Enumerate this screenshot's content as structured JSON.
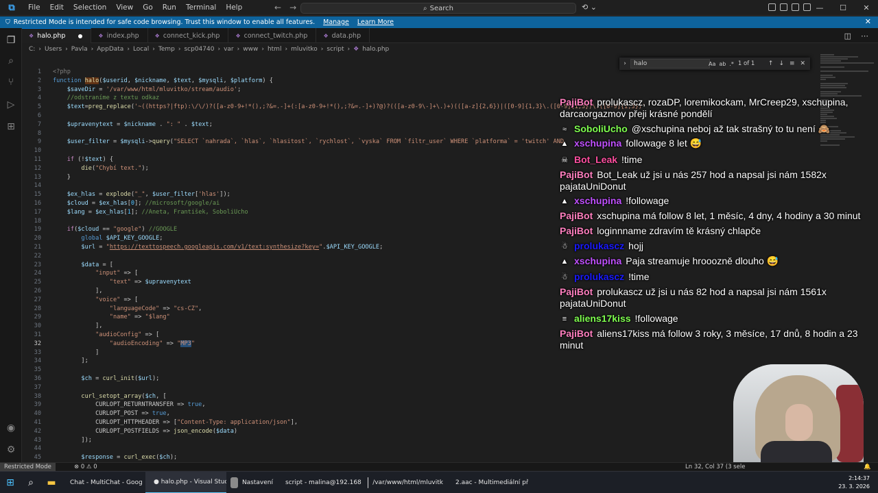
{
  "titlebar": {
    "menu": [
      "File",
      "Edit",
      "Selection",
      "View",
      "Go",
      "Run",
      "Terminal",
      "Help"
    ],
    "search_label": "Search"
  },
  "banner": {
    "text": "Restricted Mode is intended for safe code browsing. Trust this window to enable all features.",
    "manage": "Manage",
    "learn_more": "Learn More"
  },
  "tabs": [
    "halo.php",
    "index.php",
    "connect_kick.php",
    "connect_twitch.php",
    "data.php"
  ],
  "breadcrumb": [
    "C:",
    "Users",
    "Pavla",
    "AppData",
    "Local",
    "Temp",
    "scp04740",
    "var",
    "www",
    "html",
    "mluvitko",
    "script",
    "halo.php"
  ],
  "find": {
    "query": "halo",
    "count": "1 of 1",
    "opt_case": "Aa",
    "opt_word": "ab",
    "opt_regex": ".*"
  },
  "editor": {
    "line_numbers": [
      "1",
      "2",
      "3",
      "4",
      "5",
      "6",
      "7",
      "8",
      "9",
      "10",
      "11",
      "12",
      "13",
      "14",
      "15",
      "16",
      "17",
      "18",
      "19",
      "20",
      "21",
      "22",
      "23",
      "24",
      "25",
      "26",
      "27",
      "28",
      "29",
      "30",
      "31",
      "32",
      "33",
      "34",
      "35",
      "36",
      "37",
      "38",
      "39",
      "40",
      "41",
      "42",
      "43",
      "44",
      "45"
    ],
    "current_line": "32"
  },
  "chat": [
    {
      "user": "PajiBot",
      "color": "#ff7fbf",
      "badge": "",
      "text": "prolukascz, rozaDP, loremikockam, MrCreep29, xschupina, darcaorgazmov přeji krásné pondělí"
    },
    {
      "user": "SoboliUcho",
      "color": "#7fff4f",
      "badge": "≈",
      "text": "@xschupina neboj až tak strašný to tu není 🙈"
    },
    {
      "user": "xschupina",
      "color": "#c050ff",
      "badge": "▲",
      "text": "followage 8 let 😅"
    },
    {
      "user": "Bot_Leak",
      "color": "#ff4fa0",
      "badge": "☠",
      "text": "!time"
    },
    {
      "user": "PajiBot",
      "color": "#ff7fbf",
      "badge": "",
      "text": "Bot_Leak už jsi u nás 257 hod a napsal jsi nám 1582x pajataUniDonut"
    },
    {
      "user": "xschupina",
      "color": "#c050ff",
      "badge": "▲",
      "text": "!followage"
    },
    {
      "user": "PajiBot",
      "color": "#ff7fbf",
      "badge": "",
      "text": "xschupina má follow 8 let, 1 měsíc, 4 dny, 4 hodiny a 30 minut"
    },
    {
      "user": "PajiBot",
      "color": "#ff7fbf",
      "badge": "",
      "text": "loginnname zdravím tě krásný chlapče"
    },
    {
      "user": "prolukascz",
      "color": "#1a1aff",
      "badge": "☃",
      "text": "hojj"
    },
    {
      "user": "xschupina",
      "color": "#c050ff",
      "badge": "▲",
      "text": "Paja streamuje hrooozně dlouho 😅"
    },
    {
      "user": "prolukascz",
      "color": "#1a1aff",
      "badge": "☃",
      "text": "!time"
    },
    {
      "user": "PajiBot",
      "color": "#ff7fbf",
      "badge": "",
      "text": "prolukascz už jsi u nás 82 hod a napsal jsi nám 1561x pajataUniDonut"
    },
    {
      "user": "aliens17kiss",
      "color": "#7fff4f",
      "badge": "≡",
      "text": "!followage"
    },
    {
      "user": "PajiBot",
      "color": "#ff7fbf",
      "badge": "",
      "text": "aliens17kiss má follow 3 roky, 3 měsíce, 17 dnů, 8 hodin a 23 minut"
    }
  ],
  "statusbar": {
    "restricted": "Restricted Mode",
    "problems": "⊗ 0 ⚠ 0",
    "cursor": "Ln 32, Col 37 (3 sele"
  },
  "taskbar": {
    "apps": [
      {
        "label": "Chat - MultiChat - Goog",
        "icon": "chrome-icon",
        "color": "#e8453c"
      },
      {
        "label": "● halo.php - Visual Stud",
        "icon": "vscode-icon",
        "color": "#2f8fe0"
      },
      {
        "label": "Nastavení",
        "icon": "settings-icon",
        "color": "#8a8a8a"
      },
      {
        "label": "script - malina@192.168",
        "icon": "winscp-icon",
        "color": "#4aa54a"
      },
      {
        "label": "/var/www/html/mluvitk",
        "icon": "editor-icon",
        "color": "#dddddd"
      },
      {
        "label": "2.aac - Multimediální př",
        "icon": "vlc-icon",
        "color": "#f08a00"
      }
    ],
    "time": "2:14:37",
    "date": "23. 3. 2026"
  }
}
